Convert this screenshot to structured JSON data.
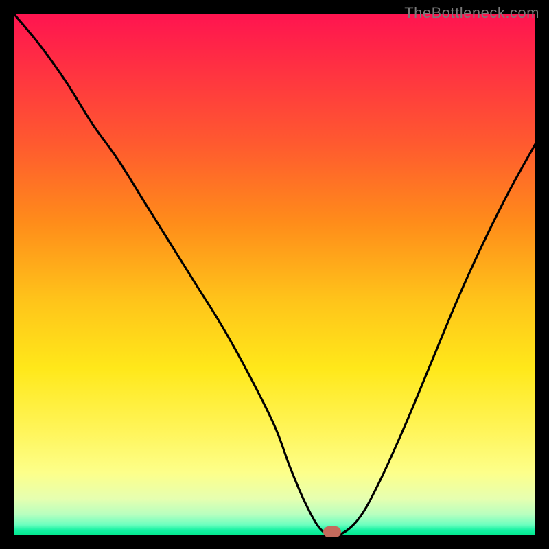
{
  "watermark": "TheBottleneck.com",
  "chart_data": {
    "type": "line",
    "title": "",
    "xlabel": "",
    "ylabel": "",
    "xlim": [
      0,
      100
    ],
    "ylim": [
      0,
      100
    ],
    "x": [
      0,
      5,
      10,
      15,
      20,
      25,
      30,
      35,
      40,
      45,
      50,
      53,
      56,
      59,
      62,
      66,
      70,
      75,
      80,
      85,
      90,
      95,
      100
    ],
    "values": [
      100,
      94,
      87,
      79,
      72,
      64,
      56,
      48,
      40,
      31,
      21,
      13,
      6,
      1,
      0,
      3,
      10,
      21,
      33,
      45,
      56,
      66,
      75
    ],
    "minimum_x": 61,
    "minimum_y": 0,
    "gradient_stops": [
      {
        "pos": 0.0,
        "color": "#ff1450"
      },
      {
        "pos": 0.25,
        "color": "#ff5a2f"
      },
      {
        "pos": 0.55,
        "color": "#ffc41a"
      },
      {
        "pos": 0.8,
        "color": "#fff55a"
      },
      {
        "pos": 0.96,
        "color": "#b8ffbf"
      },
      {
        "pos": 1.0,
        "color": "#00e88c"
      }
    ],
    "marker": {
      "x": 61,
      "y": 0,
      "color": "#c46a5c"
    }
  }
}
